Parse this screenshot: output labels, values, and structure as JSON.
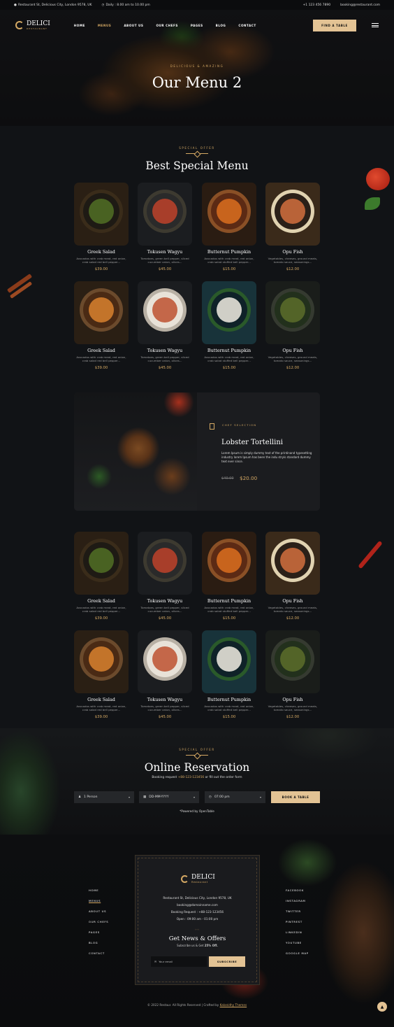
{
  "topbar": {
    "address": "Restaurant St, Delicious City, London 9578, UK",
    "hours": "Daily : 8.00 am to 10.00 pm",
    "phone": "+1 123 456 7890",
    "email": "booking@restaurant.com"
  },
  "nav": {
    "logo_name": "DELICI",
    "logo_sub": "RESTAURANT",
    "items": [
      "HOME",
      "MENUS",
      "ABOUT US",
      "OUR CHEFS",
      "PAGES",
      "BLOG",
      "CONTACT"
    ],
    "active": "MENUS",
    "cta": "FIND A TABLE"
  },
  "hero": {
    "eyebrow": "DELICIOUS & AMAZING",
    "title": "Our Menu 2"
  },
  "special": {
    "eyebrow": "SPECIAL OFFER",
    "title": "Best Special Menu"
  },
  "menu_rows": [
    [
      {
        "name": "Greek Salad",
        "desc1": "Avocados with crab meat, red onion,",
        "desc2": "crab salad red bell pepper...",
        "price": "$39.00"
      },
      {
        "name": "Tokusen Wagyu",
        "desc1": "Tomatoes, green bell pepper, sliced",
        "desc2": "cucumber onion, olives...",
        "price": "$45.00"
      },
      {
        "name": "Butternut Pumpkin",
        "desc1": "Avocados with crab meat, red onion,",
        "desc2": "crab salad stuffed bell pepper...",
        "price": "$15.00"
      },
      {
        "name": "Opu Fish",
        "desc1": "Vegetables, cheeses, ground meats,",
        "desc2": "tomato sauce, seasonings...",
        "price": "$12.00"
      }
    ],
    [
      {
        "name": "Greek Salad",
        "desc1": "Avocados with crab meat, red onion,",
        "desc2": "crab salad red bell pepper...",
        "price": "$39.00"
      },
      {
        "name": "Tokusen Wagyu",
        "desc1": "Tomatoes, green bell pepper, sliced",
        "desc2": "cucumber onion, olives...",
        "price": "$45.00"
      },
      {
        "name": "Butternut Pumpkin",
        "desc1": "Avocados with crab meat, red onion,",
        "desc2": "crab salad stuffed bell pepper...",
        "price": "$15.00"
      },
      {
        "name": "Opu Fish",
        "desc1": "Vegetables, cheeses, ground meats,",
        "desc2": "tomato sauce, seasonings...",
        "price": "$12.00"
      }
    ],
    [
      {
        "name": "Greek Salad",
        "desc1": "Avocados with crab meat, red onion,",
        "desc2": "crab salad red bell pepper...",
        "price": "$39.00"
      },
      {
        "name": "Tokusen Wagyu",
        "desc1": "Tomatoes, green bell pepper, sliced",
        "desc2": "cucumber onion, olives...",
        "price": "$45.00"
      },
      {
        "name": "Butternut Pumpkin",
        "desc1": "Avocados with crab meat, red onion,",
        "desc2": "crab salad stuffed bell pepper...",
        "price": "$15.00"
      },
      {
        "name": "Opu Fish",
        "desc1": "Vegetables, cheeses, ground meats,",
        "desc2": "tomato sauce, seasonings...",
        "price": "$12.00"
      }
    ],
    [
      {
        "name": "Greek Salad",
        "desc1": "Avocados with crab meat, red onion,",
        "desc2": "crab salad red bell pepper...",
        "price": "$39.00"
      },
      {
        "name": "Tokusen Wagyu",
        "desc1": "Tomatoes, green bell pepper, sliced",
        "desc2": "cucumber onion, olives...",
        "price": "$45.00"
      },
      {
        "name": "Butternut Pumpkin",
        "desc1": "Avocados with crab meat, red onion,",
        "desc2": "crab salad stuffed bell pepper...",
        "price": "$15.00"
      },
      {
        "name": "Opu Fish",
        "desc1": "Vegetables, cheeses, ground meats,",
        "desc2": "tomato sauce, seasonings...",
        "price": "$12.00"
      }
    ]
  ],
  "feature": {
    "eyebrow": "CHEF SELECTION",
    "title": "Lobster Tortellini",
    "text": "Lorem Ipsum is simply dummy text of the printinand typesetting industry lorem Ipsum has been the indu stryís standard dummy text ever since.",
    "old_price": "$40.00",
    "new_price": "$20.00"
  },
  "reservation": {
    "eyebrow": "SPECIAL OFFER",
    "title": "Online Reservation",
    "line_prefix": "Booking request ",
    "line_phone": "+88-123-123456",
    "line_suffix": " or fill out the order form",
    "persons": "1 Person",
    "date": "DD-MM-YYYY",
    "time": "07:00 pm",
    "button": "BOOK A TABLE",
    "powered": "*Powered by OpenTable"
  },
  "footer": {
    "left_links": [
      "HOME",
      "MENUS",
      "ABOUT US",
      "OUR CHEFS",
      "PAGES",
      "BLOG",
      "CONTACT"
    ],
    "left_active": "MENUS",
    "right_links": [
      "FACEBOOK",
      "INSTAGRAM",
      "TWITTER",
      "PINTREST",
      "LINKEDIN",
      "YOUTUBE",
      "GOOGLE MAP"
    ],
    "logo_name": "DELICI",
    "logo_sub": "Restaurant",
    "address": "Restaurant St, Delicious City, London 9578, UK",
    "email": "booking@domainname.com",
    "booking": "Booking Request : +88-123-123456",
    "open": "Open : 09:00 am - 01:00 pm",
    "news_title": "Get News & Offers",
    "news_sub_prefix": "Subscribe us & Get ",
    "news_sub_bold": "25% Off.",
    "email_placeholder": "Your email",
    "subscribe": "SUBSCRIBE",
    "copyright": "© 2022 Restaur. All Rights Reserved   |   Crafted by ",
    "crafted": "Kalanidhy Themes"
  },
  "colors": {
    "accent": "#d5a964",
    "button": "#e3c394",
    "background": "#111316"
  }
}
